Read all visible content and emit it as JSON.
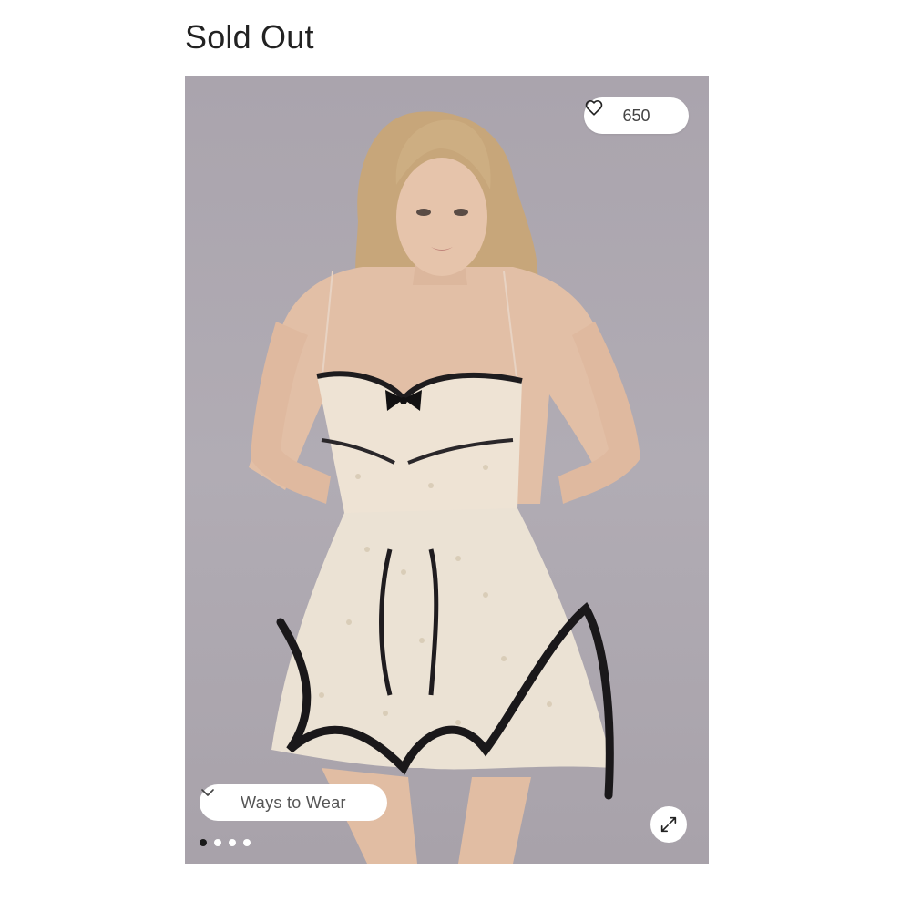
{
  "page": {
    "title": "Sold Out"
  },
  "gallery": {
    "likes_count": "650",
    "heart_icon": "heart-outline-icon",
    "ways_to_wear_label": "Ways to Wear",
    "chevron_icon": "chevron-down-icon",
    "expand_icon": "expand-arrows-icon",
    "dots": [
      {
        "active": true
      },
      {
        "active": false
      },
      {
        "active": false
      },
      {
        "active": false
      }
    ]
  },
  "colors": {
    "photo_background": "#aca7af",
    "active_dot": "#1a1a1a",
    "pill_background": "#ffffff"
  }
}
